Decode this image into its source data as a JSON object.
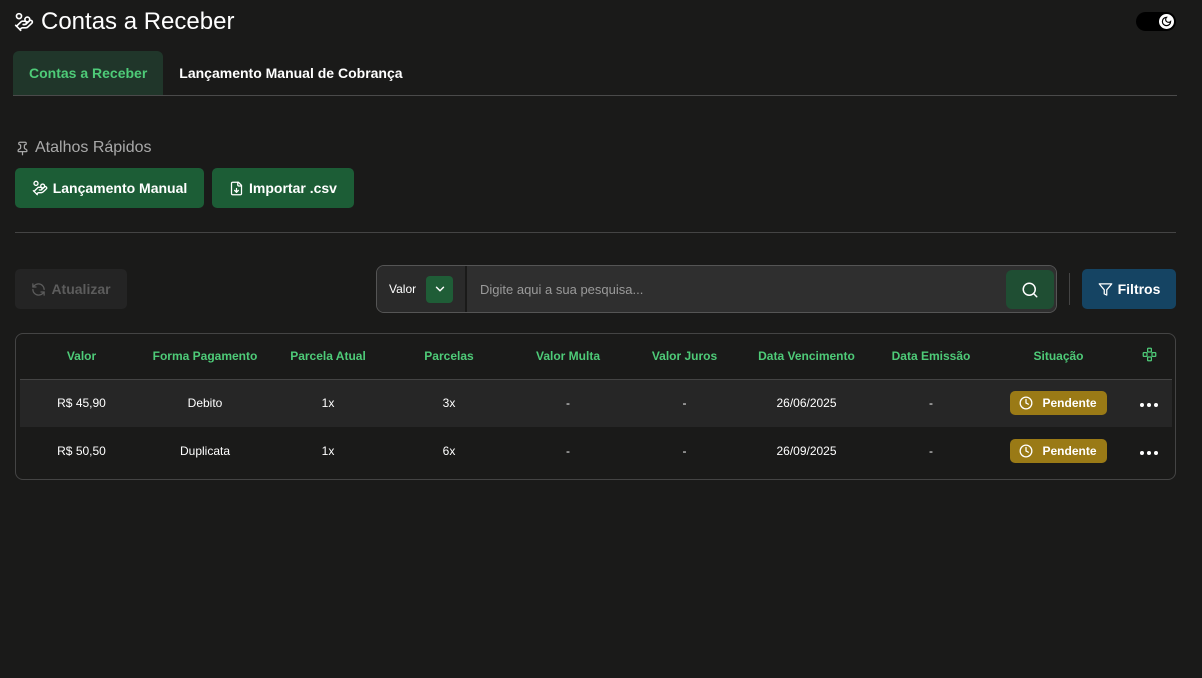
{
  "page": {
    "title": "Contas a Receber"
  },
  "tabs": [
    {
      "label": "Contas a Receber",
      "active": true
    },
    {
      "label": "Lançamento Manual de Cobrança",
      "active": false
    }
  ],
  "shortcuts": {
    "label": "Atalhos Rápidos",
    "manual_label": "Lançamento Manual",
    "import_label": "Importar .csv"
  },
  "toolbar": {
    "refresh_label": "Atualizar",
    "search_field": "Valor",
    "search_placeholder": "Digite aqui a sua pesquisa...",
    "filter_label": "Filtros"
  },
  "table": {
    "columns": [
      "Valor",
      "Forma Pagamento",
      "Parcela Atual",
      "Parcelas",
      "Valor Multa",
      "Valor Juros",
      "Data Vencimento",
      "Data Emissão",
      "Situação"
    ],
    "rows": [
      {
        "valor": "R$ 45,90",
        "forma": "Debito",
        "parcela_atual": "1x",
        "parcelas": "3x",
        "multa": "-",
        "juros": "-",
        "vencimento": "26/06/2025",
        "emissao": "-",
        "situacao": "Pendente"
      },
      {
        "valor": "R$ 50,50",
        "forma": "Duplicata",
        "parcela_atual": "1x",
        "parcelas": "6x",
        "multa": "-",
        "juros": "-",
        "vencimento": "26/09/2025",
        "emissao": "-",
        "situacao": "Pendente"
      }
    ]
  },
  "colors": {
    "accent_green": "#4ecb78",
    "button_green": "#1c5d36",
    "filter_blue": "#154463",
    "pending_gold": "#9a7a16"
  },
  "icons": {
    "title": "hand-coins-icon",
    "pin": "pin-icon",
    "import": "file-download-icon",
    "refresh": "refresh-icon",
    "search": "search-icon",
    "filter": "filter-icon",
    "columns": "workflow-icon",
    "status": "clock-icon",
    "actions": "more-horizontal-icon"
  }
}
